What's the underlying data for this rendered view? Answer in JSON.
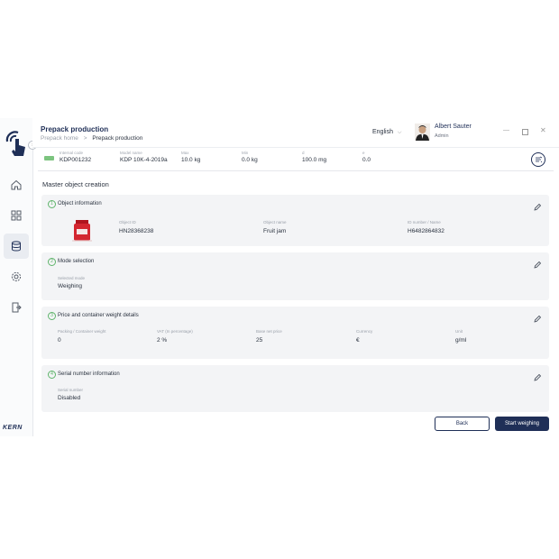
{
  "app": {
    "title": "Prepack production",
    "breadcrumb": [
      "Prepack home",
      ">",
      "Prepack production"
    ],
    "brand": "KERN"
  },
  "header": {
    "language": "English",
    "user_name": "Albert Sauter",
    "user_role": "Admin"
  },
  "scale_info": [
    {
      "label": "Internal code",
      "value": "KDP001232"
    },
    {
      "label": "Model name",
      "value": "KDP 10K-4-2019a"
    },
    {
      "label": "Max",
      "value": "10.0 kg"
    },
    {
      "label": "Min",
      "value": "0.0 kg"
    },
    {
      "label": "d",
      "value": "100.0 mg"
    },
    {
      "label": "e",
      "value": "0.0"
    }
  ],
  "page": {
    "heading": "Master object creation"
  },
  "sections": {
    "object": {
      "num": "1",
      "title": "Object information",
      "fields": [
        {
          "label": "Object ID",
          "value": "HN28368238"
        },
        {
          "label": "Object name",
          "value": "Fruit jam"
        },
        {
          "label": "ID number / Name",
          "value": "H6482864832"
        }
      ]
    },
    "mode": {
      "num": "2",
      "title": "Mode selection",
      "fields": [
        {
          "label": "Selected mode",
          "value": "Weighing"
        }
      ]
    },
    "price": {
      "num": "3",
      "title": "Price and container weight details",
      "fields": [
        {
          "label": "Packing / Container weight",
          "value": "0"
        },
        {
          "label": "VAT (In percentage)",
          "value": "2 %"
        },
        {
          "label": "Base net price",
          "value": "25"
        },
        {
          "label": "Currency",
          "value": "€"
        },
        {
          "label": "Unit",
          "value": "g/ml"
        }
      ]
    },
    "serial": {
      "num": "4",
      "title": "Serial number information",
      "fields": [
        {
          "label": "Serial number",
          "value": "Disabled"
        }
      ]
    }
  },
  "buttons": {
    "back": "Back",
    "start": "Start weighing"
  },
  "colors": {
    "accent": "#1f2f57",
    "success": "#5fb46b",
    "product": "#d32630"
  }
}
